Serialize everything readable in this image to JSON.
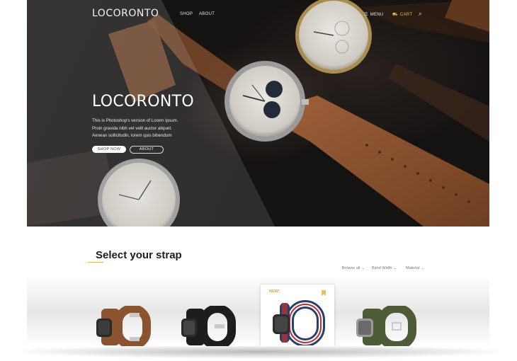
{
  "nav": {
    "logo": "LOCORONTO",
    "links": [
      "SHOP",
      "ABOUT"
    ],
    "menu": "MENU",
    "cart": "CART",
    "icons": {
      "menu": "hamburger-icon",
      "cart": "cart-icon",
      "search": "search-icon"
    }
  },
  "hero": {
    "title": "LOCORONTO",
    "description": [
      "This is Photoshop's version  of Lorem Ipsum.",
      "Proin gravida nibh vel velit auctor aliquet.",
      "Aenean sollicitudin, lorem quis bibendum"
    ],
    "buttons": {
      "shop": "SHOP NOW",
      "about": "ABOUT"
    }
  },
  "section": {
    "title": "Select your strap",
    "filters": [
      "Browse all",
      "Band Width",
      "Material"
    ],
    "badge": "NEW!",
    "products": [
      "brown leather band",
      "black leather band",
      "striped nato band",
      "green canvas band"
    ]
  },
  "colors": {
    "accent": "#d8a23a",
    "hero_bg": "#151312",
    "strap_brown": "#8a5431"
  }
}
